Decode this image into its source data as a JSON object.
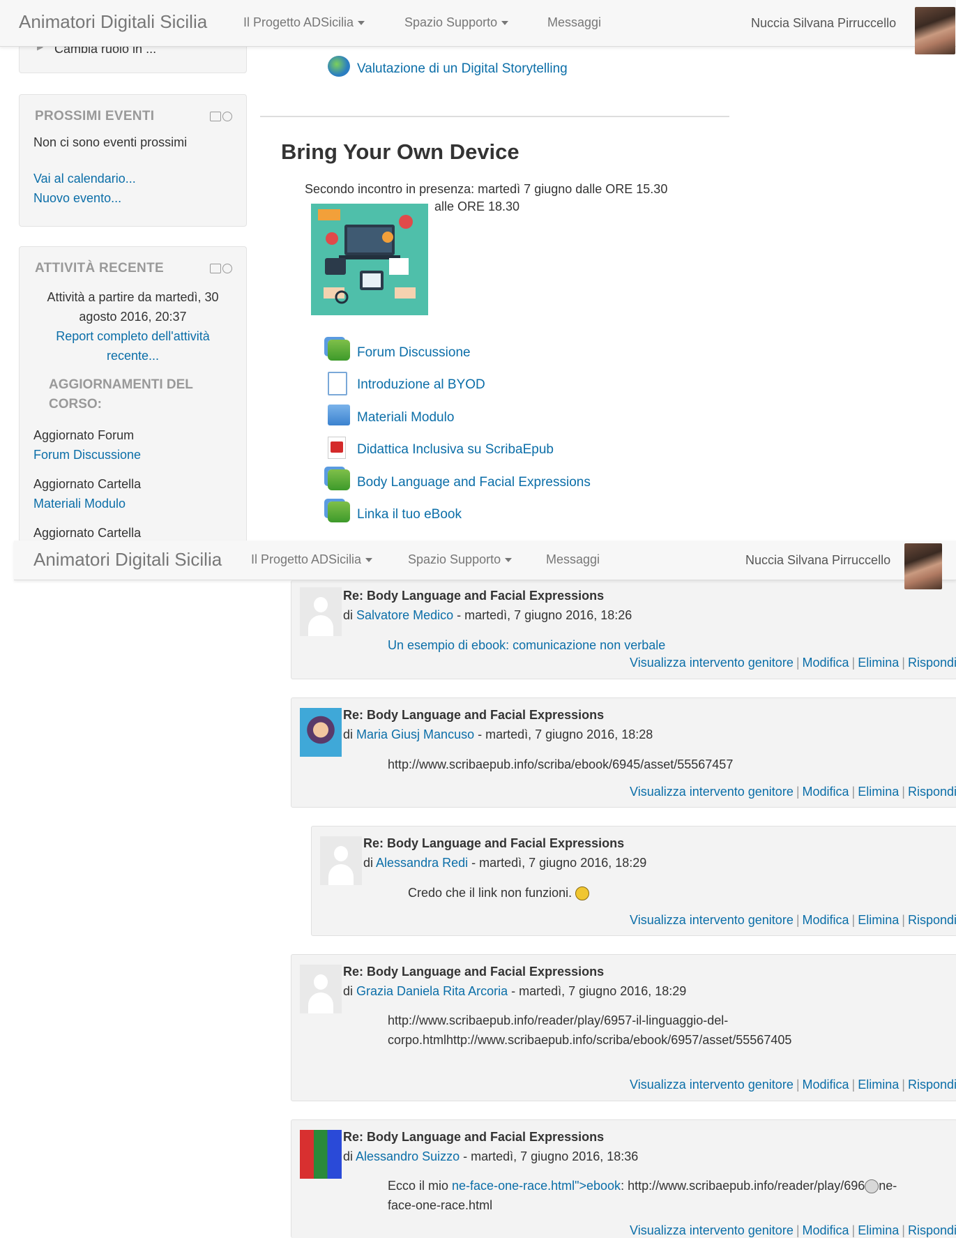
{
  "navbar": {
    "brand": "Animatori Digitali Sicilia",
    "menu1": "Il Progetto ADSicilia",
    "menu2": "Spazio Supporto",
    "menu3": "Messaggi",
    "user": "Nuccia Silvana Pirruccello"
  },
  "admin": {
    "cambia_ruolo": "Cambia ruolo in ..."
  },
  "events": {
    "title": "PROSSIMI EVENTI",
    "empty": "Non ci sono eventi prossimi",
    "calendar_link": "Vai al calendario...",
    "new_event_link": "Nuovo evento..."
  },
  "recent": {
    "title": "ATTIVITÀ RECENTE",
    "since_line1": "Attività a partire da martedì, 30",
    "since_line2": "agosto 2016, 20:37",
    "report_line1": "Report completo dell'attività",
    "report_line2": "recente...",
    "updates_line1": "AGGIORNAMENTI DEL",
    "updates_line2": "CORSO:",
    "items": [
      {
        "label": "Aggiornato Forum",
        "link": "Forum Discussione"
      },
      {
        "label": "Aggiornato Cartella",
        "link": "Materiali Modulo"
      },
      {
        "label": "Aggiornato Cartella"
      }
    ]
  },
  "course": {
    "prev_activity": "Valutazione di un Digital Storytelling",
    "section_title": "Bring Your Own Device",
    "summary_line1": "Secondo incontro in presenza: martedì 7 giugno dalle ORE 15.30",
    "summary_line2": "alle ORE 18.30",
    "activities": [
      {
        "label": "Forum Discussione",
        "icon": "forum-icon"
      },
      {
        "label": "Introduzione al BYOD",
        "icon": "page-icon"
      },
      {
        "label": "Materiali Modulo",
        "icon": "folder-icon"
      },
      {
        "label": "Didattica Inclusiva su ScribaEpub",
        "icon": "pdf-icon"
      },
      {
        "label": "Body Language and Facial Expressions",
        "icon": "forum-icon"
      },
      {
        "label": "Linka il tuo eBook",
        "icon": "forum-icon"
      }
    ]
  },
  "commands": {
    "parent": "Visualizza intervento genitore",
    "edit": "Modifica",
    "delete": "Elimina",
    "reply": "Rispondi"
  },
  "posts": [
    {
      "title": "Re: Body Language and Facial Expressions",
      "by_prefix": "di",
      "author": "Salvatore Medico",
      "date": " - martedì, 7 giugno 2016, 18:26",
      "body_link": "Un esempio di ebook: comunicazione non verbale"
    },
    {
      "title": "Re: Body Language and Facial Expressions",
      "by_prefix": "di",
      "author": "Maria Giusj Mancuso",
      "date": " - martedì, 7 giugno 2016, 18:28",
      "body": "http://www.scribaepub.info/scriba/ebook/6945/asset/55567457"
    },
    {
      "title": "Re: Body Language and Facial Expressions",
      "by_prefix": "di",
      "author": "Alessandra Redi",
      "date": " - martedì, 7 giugno 2016, 18:29",
      "body": "Credo che il link non funzioni."
    },
    {
      "title": "Re: Body Language and Facial Expressions",
      "by_prefix": "di",
      "author": "Grazia Daniela Rita Arcoria",
      "date": " - martedì, 7 giugno 2016, 18:29",
      "body_line1": "http://www.scribaepub.info/reader/play/6957-il-linguaggio-del-",
      "body_line2": "corpo.htmlhttp://www.scribaepub.info/scriba/ebook/6957/asset/55567405"
    },
    {
      "title": "Re: Body Language and Facial Expressions",
      "by_prefix": "di",
      "author": "Alessandro Suizzo",
      "date": " - martedì, 7 giugno 2016, 18:36",
      "body_pre": "Ecco il mio ",
      "body_link": "ne-face-one-race.html\">ebook",
      "body_post": ": http://www.scribaepub.info/reader/play/696",
      "body_post2": "ne-",
      "body_line2": "face-one-race.html"
    }
  ]
}
